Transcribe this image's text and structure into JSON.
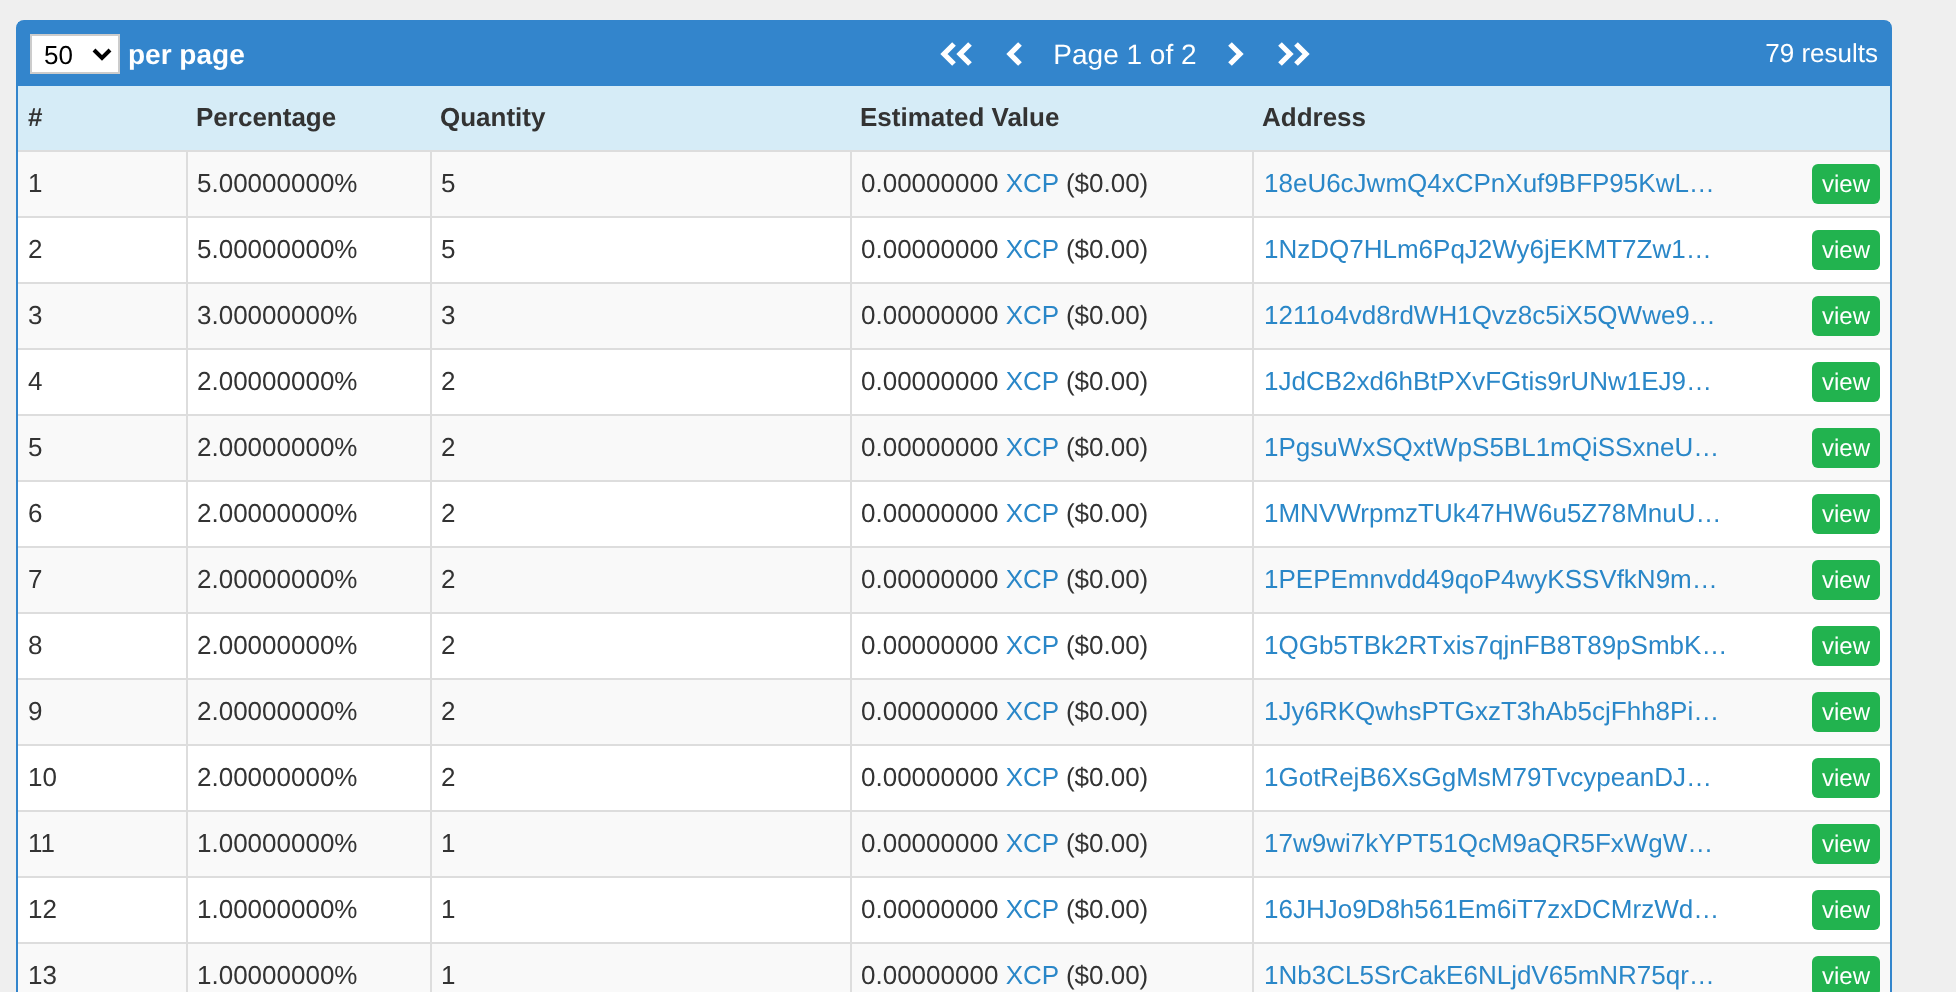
{
  "toolbar": {
    "per_page": "50",
    "per_page_label": "per page",
    "page_label": "Page 1 of 2",
    "results": "79 results"
  },
  "table": {
    "columns": [
      "#",
      "Percentage",
      "Quantity",
      "Estimated Value",
      "Address"
    ],
    "rows": [
      {
        "n": "1",
        "percentage": "5.00000000%",
        "quantity": "5",
        "value": "0.00000000",
        "asset": "XCP",
        "usd": "($0.00)",
        "address": "18eU6cJwmQ4xCPnXuf9BFP95KwL…",
        "action": "view"
      },
      {
        "n": "2",
        "percentage": "5.00000000%",
        "quantity": "5",
        "value": "0.00000000",
        "asset": "XCP",
        "usd": "($0.00)",
        "address": "1NzDQ7HLm6PqJ2Wy6jEKMT7Zw1…",
        "action": "view"
      },
      {
        "n": "3",
        "percentage": "3.00000000%",
        "quantity": "3",
        "value": "0.00000000",
        "asset": "XCP",
        "usd": "($0.00)",
        "address": "1211o4vd8rdWH1Qvz8c5iX5QWwe9…",
        "action": "view"
      },
      {
        "n": "4",
        "percentage": "2.00000000%",
        "quantity": "2",
        "value": "0.00000000",
        "asset": "XCP",
        "usd": "($0.00)",
        "address": "1JdCB2xd6hBtPXvFGtis9rUNw1EJ9…",
        "action": "view"
      },
      {
        "n": "5",
        "percentage": "2.00000000%",
        "quantity": "2",
        "value": "0.00000000",
        "asset": "XCP",
        "usd": "($0.00)",
        "address": "1PgsuWxSQxtWpS5BL1mQiSSxneU…",
        "action": "view"
      },
      {
        "n": "6",
        "percentage": "2.00000000%",
        "quantity": "2",
        "value": "0.00000000",
        "asset": "XCP",
        "usd": "($0.00)",
        "address": "1MNVWrpmzTUk47HW6u5Z78MnuU…",
        "action": "view"
      },
      {
        "n": "7",
        "percentage": "2.00000000%",
        "quantity": "2",
        "value": "0.00000000",
        "asset": "XCP",
        "usd": "($0.00)",
        "address": "1PEPEmnvdd49qoP4wyKSSVfkN9m…",
        "action": "view"
      },
      {
        "n": "8",
        "percentage": "2.00000000%",
        "quantity": "2",
        "value": "0.00000000",
        "asset": "XCP",
        "usd": "($0.00)",
        "address": "1QGb5TBk2RTxis7qjnFB8T89pSmbK…",
        "action": "view"
      },
      {
        "n": "9",
        "percentage": "2.00000000%",
        "quantity": "2",
        "value": "0.00000000",
        "asset": "XCP",
        "usd": "($0.00)",
        "address": "1Jy6RKQwhsPTGxzT3hAb5cjFhh8Pi…",
        "action": "view"
      },
      {
        "n": "10",
        "percentage": "2.00000000%",
        "quantity": "2",
        "value": "0.00000000",
        "asset": "XCP",
        "usd": "($0.00)",
        "address": "1GotRejB6XsGgMsM79TvcypeanDJ…",
        "action": "view"
      },
      {
        "n": "11",
        "percentage": "1.00000000%",
        "quantity": "1",
        "value": "0.00000000",
        "asset": "XCP",
        "usd": "($0.00)",
        "address": "17w9wi7kYPT51QcM9aQR5FxWgW…",
        "action": "view"
      },
      {
        "n": "12",
        "percentage": "1.00000000%",
        "quantity": "1",
        "value": "0.00000000",
        "asset": "XCP",
        "usd": "($0.00)",
        "address": "16JHJo9D8h561Em6iT7zxDCMrzWd…",
        "action": "view"
      },
      {
        "n": "13",
        "percentage": "1.00000000%",
        "quantity": "1",
        "value": "0.00000000",
        "asset": "XCP",
        "usd": "($0.00)",
        "address": "1Nb3CL5SrCakE6NLjdV65mNR75qr…",
        "action": "view"
      }
    ]
  }
}
